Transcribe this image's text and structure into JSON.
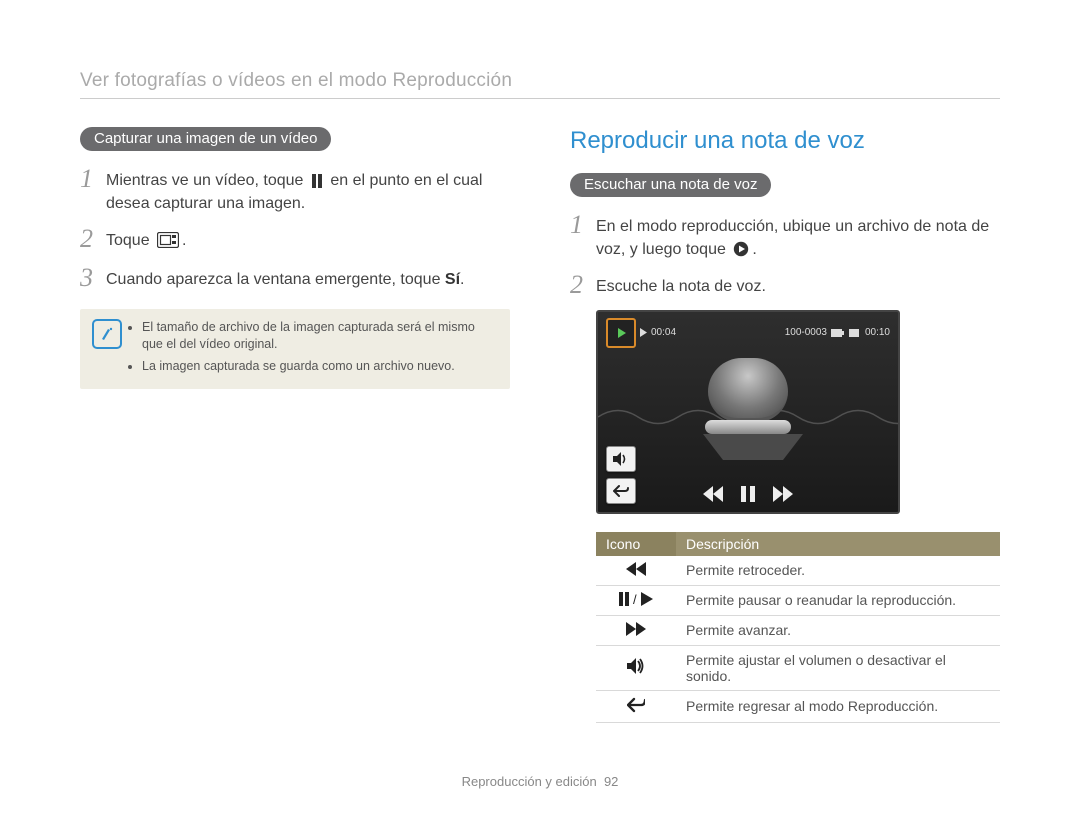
{
  "breadcrumb": "Ver fotografías o vídeos en el modo Reproducción",
  "left": {
    "pill": "Capturar una imagen de un vídeo",
    "steps": [
      {
        "num": "1",
        "pre": "Mientras ve un vídeo, toque ",
        "icon": "pause",
        "post": " en el punto en el cual desea capturar una imagen."
      },
      {
        "num": "2",
        "pre": "Toque ",
        "icon": "capture-frame",
        "post": "."
      },
      {
        "num": "3",
        "pre": "Cuando aparezca la ventana emergente, toque ",
        "bold": "Sí",
        "post": "."
      }
    ],
    "notes": [
      "El tamaño de archivo de la imagen capturada será el mismo que el del vídeo original.",
      "La imagen capturada se guarda como un archivo nuevo."
    ]
  },
  "right": {
    "title": "Reproducir una nota de voz",
    "pill": "Escuchar una nota de voz",
    "steps": [
      {
        "num": "1",
        "pre": "En el modo reproducción, ubique un archivo de nota de voz, y luego toque ",
        "icon": "play-circle",
        "post": "."
      },
      {
        "num": "2",
        "pre": "Escuche la nota de voz.",
        "post": ""
      }
    ],
    "screenshot": {
      "time_elapsed": "00:04",
      "file_index": "100-0003",
      "time_total": "00:10"
    },
    "table": {
      "headers": [
        "Icono",
        "Descripción"
      ],
      "rows": [
        {
          "icon": "rewind",
          "desc": "Permite retroceder."
        },
        {
          "icon": "pause-play",
          "desc": "Permite pausar o reanudar la reproducción."
        },
        {
          "icon": "forward",
          "desc": "Permite avanzar."
        },
        {
          "icon": "volume",
          "desc": "Permite ajustar el volumen o desactivar el sonido."
        },
        {
          "icon": "back",
          "desc": "Permite regresar al modo Reproducción."
        }
      ]
    }
  },
  "footer": {
    "section": "Reproducción y edición",
    "page": "92"
  }
}
